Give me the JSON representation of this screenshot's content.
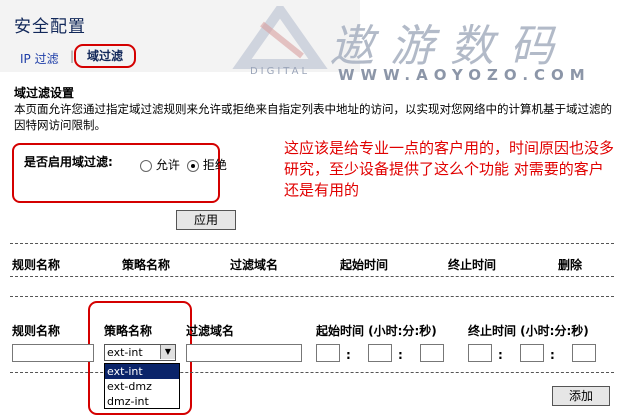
{
  "header": {
    "title": "安全配置",
    "tabs": [
      {
        "label": "IP 过滤"
      },
      {
        "label": "域过滤",
        "active": true
      }
    ],
    "separator": "|"
  },
  "watermark": {
    "brand_text": "遨游数码",
    "url": "WWW.AOYOZO.COM",
    "logo_text": "DIGITAL"
  },
  "section": {
    "title": "域过滤设置",
    "description": "本页面允许您通过指定域过滤规则来允许或拒绝来自指定列表中地址的访问，以实现对您网络中的计算机基于域过滤的因特网访问限制。"
  },
  "enable": {
    "label": "是否启用域过滤:",
    "options": [
      "允许",
      "拒绝"
    ],
    "selected": "拒绝"
  },
  "apply_label": "应用",
  "annotation": "这应该是给专业一点的客户用的，时间原因也没多研究，至少设备提供了这么个功能 对需要的客户还是有用的",
  "rules_table": {
    "headers": [
      "规则名称",
      "策略名称",
      "过滤域名",
      "起始时间",
      "终止时间",
      "删除"
    ]
  },
  "add_form": {
    "headers": [
      "规则名称",
      "策略名称",
      "过滤域名",
      "起始时间 (小时:分:秒)",
      "终止时间 (小时:分:秒)"
    ],
    "policy_selected": "ext-int",
    "policy_options": [
      "ext-int",
      "ext-dmz",
      "dmz-int"
    ],
    "colon": ":",
    "add_label": "添加"
  },
  "colors": {
    "highlight_red": "#d40000",
    "title_blue": "#12285a",
    "selection_blue": "#0a246a"
  }
}
